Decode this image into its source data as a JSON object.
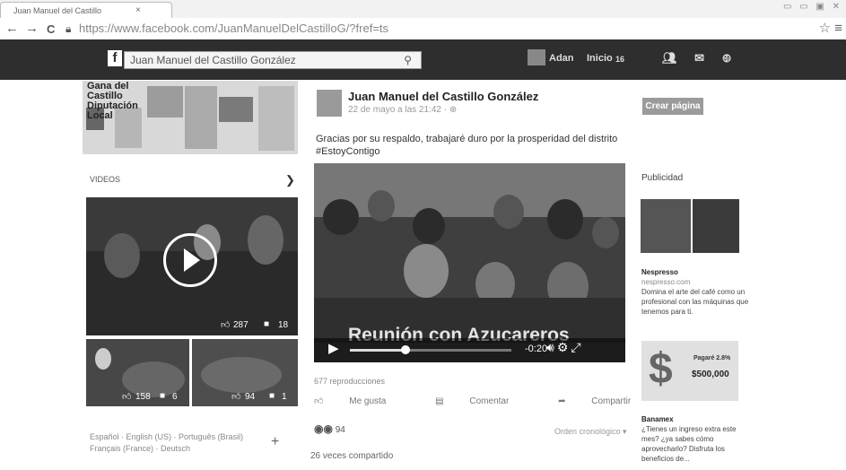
{
  "browser": {
    "tab_title": "Juan Manuel del Castillo",
    "tab_close": "×",
    "url": "https://www.facebook.com/JuanManuelDelCastilloG/?fref=ts",
    "url_domain": "www.facebook.com",
    "nav_back": "←",
    "nav_forward": "→",
    "nav_reload": "C"
  },
  "fb_bar": {
    "logo": "f",
    "search_value": "Juan Manuel del Castillo González",
    "user_name": "Adan",
    "home_label": "Inicio",
    "home_count": "16"
  },
  "left": {
    "newspaper_headline": "Gana del Castillo Diputación Local",
    "videos_label": "VIDEOS",
    "video1": {
      "likes": "287",
      "comments": "18"
    },
    "video2": {
      "likes": "158",
      "comments": "6"
    },
    "video3": {
      "likes": "94",
      "comments": "1"
    },
    "languages_line1": "Español · English (US) · Português (Brasil)",
    "languages_line2": "Français (France) · Deutsch",
    "more_languages": "+"
  },
  "post": {
    "author": "Juan Manuel del Castillo González",
    "date": "22 de mayo a las 21:42 · ",
    "text_line1": "Gracias por su respaldo, trabajaré duro por la prosperidad del distrito",
    "text_line2": "#EstoyContigo",
    "video_title": "Reunión con Azucareros",
    "video_time": "-0:20",
    "views": "677 reproducciones",
    "like_label": "Me gusta",
    "comment_label": "Comentar",
    "share_label": "Compartir",
    "reactions_count": "94",
    "sort_order": "Orden cronológico ▾",
    "shares": "26 veces compartido"
  },
  "right": {
    "create_page_label": "Crear página",
    "ads_label": "Publicidad",
    "ad1": {
      "title": "Nespresso",
      "domain": "nespresso.com",
      "text": "Domina el arte del café como un profesional con las máquinas que tenemos para ti."
    },
    "ad2": {
      "title": "Banamex",
      "img_text_line1": "Pagaré 2.8%",
      "img_text_line2": "$500,000",
      "text": "¿Tienes un ingreso extra este mes? ¿ya sabes cómo aprovecharlo? Disfruta los beneficios de..."
    }
  }
}
